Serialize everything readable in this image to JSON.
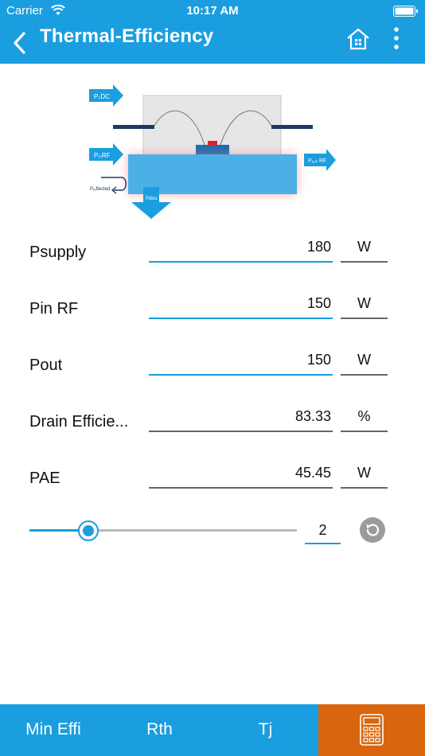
{
  "status_bar": {
    "carrier": "Carrier",
    "time": "10:17 AM"
  },
  "nav": {
    "title": "Thermal-Efficiency",
    "icons": [
      "back-icon",
      "home-icon",
      "more-icon"
    ]
  },
  "diagram": {
    "labels": {
      "pdc": "PₛDC",
      "pin_rf": "PᵢₙRF",
      "pout_rf": "Pₒᵤₜ RF",
      "preflected": "Pᵣₑflected",
      "pdiss": "Pdiss"
    }
  },
  "rows": [
    {
      "label": "Psupply",
      "value": "180",
      "unit": "W"
    },
    {
      "label": "Pin RF",
      "value": "150",
      "unit": "W"
    },
    {
      "label": "Pout",
      "value": "150",
      "unit": "W"
    },
    {
      "label": "Drain Efficie...",
      "value": "83.33",
      "unit": "%"
    },
    {
      "label": "PAE",
      "value": "45.45",
      "unit": "W"
    }
  ],
  "slider": {
    "value": "2",
    "fraction": 0.22
  },
  "tabs": [
    {
      "label": "Min Effi"
    },
    {
      "label": "Rth"
    },
    {
      "label": "Tj"
    }
  ],
  "colors": {
    "primary": "#1a9ee0",
    "accent": "#d9660e",
    "underline_gray": "#666666"
  }
}
